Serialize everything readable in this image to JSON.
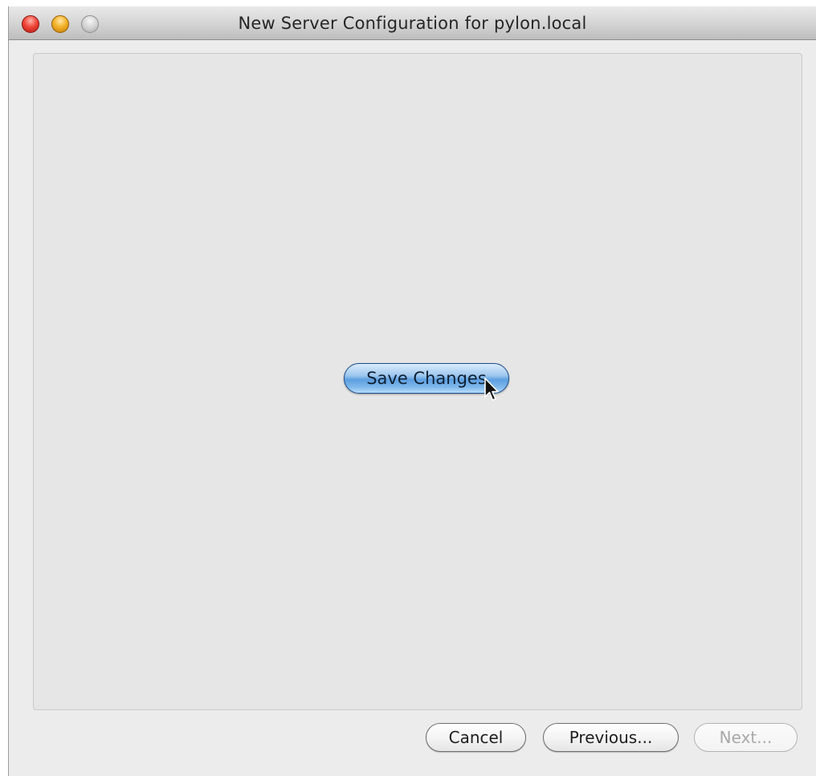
{
  "window": {
    "title": "New Server Configuration for pylon.local",
    "controls": {
      "close_icon": "close-icon",
      "minimize_icon": "minimize-icon",
      "zoom_icon": "zoom-icon"
    }
  },
  "main": {
    "save_button_label": "Save Changes"
  },
  "footer": {
    "cancel_label": "Cancel",
    "previous_label": "Previous...",
    "next_label": "Next...",
    "next_enabled": false
  },
  "cursor": {
    "icon": "mouse-pointer-icon"
  },
  "colors": {
    "accent": "#5d9fe0",
    "close": "#f0463a",
    "minimize": "#f4b22a",
    "zoom_disabled": "#d0d0d0",
    "disabled_text": "#a9a9a9"
  }
}
